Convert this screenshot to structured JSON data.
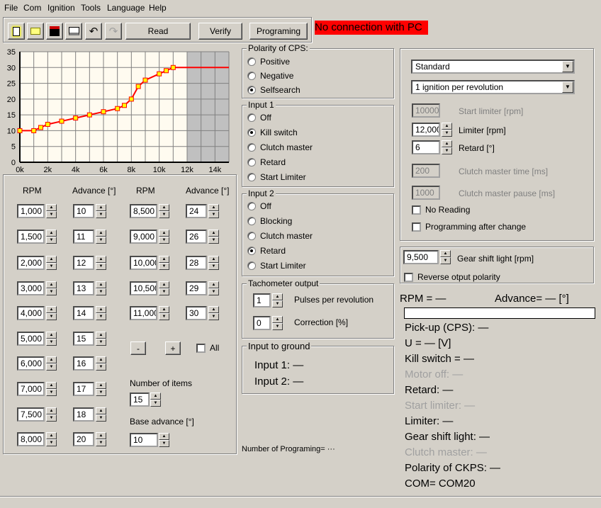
{
  "menu": [
    "File",
    "Com",
    "Ignition",
    "Tools",
    "Language",
    "Help"
  ],
  "toolbar": {
    "icons": [
      "new-file-icon",
      "open-folder-icon",
      "save-icon",
      "print-icon",
      "undo-icon",
      "redo-icon"
    ],
    "read": "Read",
    "verify": "Verify",
    "programing": "Programing"
  },
  "connection_status": "No connection with PC",
  "colors": {
    "status_bg": "#ff0000",
    "curve": "#ff0000",
    "point": "#ffff00",
    "plot_bg": "#fffbf0",
    "disabled_region": "#c0c0c0"
  },
  "chart_data": {
    "type": "line",
    "xlim": [
      0,
      15000
    ],
    "ylim": [
      0,
      35
    ],
    "grid": true,
    "xticks": [
      "0k",
      "2k",
      "4k",
      "6k",
      "8k",
      "10k",
      "12k",
      "14k"
    ],
    "yticks": [
      "0",
      "5",
      "10",
      "15",
      "20",
      "25",
      "30",
      "35"
    ],
    "points": [
      [
        0,
        10
      ],
      [
        1000,
        10
      ],
      [
        1500,
        11
      ],
      [
        2000,
        12
      ],
      [
        3000,
        13
      ],
      [
        4000,
        14
      ],
      [
        5000,
        15
      ],
      [
        6000,
        16
      ],
      [
        7000,
        17
      ],
      [
        7500,
        18
      ],
      [
        8000,
        20
      ],
      [
        8500,
        24
      ],
      [
        9000,
        26
      ],
      [
        10000,
        28
      ],
      [
        10500,
        29
      ],
      [
        11000,
        30
      ]
    ],
    "line_extends_to": 15000,
    "shaded_from": 12000
  },
  "table": {
    "headers": [
      "RPM",
      "Advance [°]",
      "RPM",
      "Advance [°]"
    ],
    "col1": [
      {
        "rpm": "1,000",
        "adv": "10"
      },
      {
        "rpm": "1,500",
        "adv": "11"
      },
      {
        "rpm": "2,000",
        "adv": "12"
      },
      {
        "rpm": "3,000",
        "adv": "13"
      },
      {
        "rpm": "4,000",
        "adv": "14"
      },
      {
        "rpm": "5,000",
        "adv": "15"
      },
      {
        "rpm": "6,000",
        "adv": "16"
      },
      {
        "rpm": "7,000",
        "adv": "17"
      },
      {
        "rpm": "7,500",
        "adv": "18"
      },
      {
        "rpm": "8,000",
        "adv": "20"
      }
    ],
    "col2": [
      {
        "rpm": "8,500",
        "adv": "24"
      },
      {
        "rpm": "9,000",
        "adv": "26"
      },
      {
        "rpm": "10,000",
        "adv": "28"
      },
      {
        "rpm": "10,500",
        "adv": "29"
      },
      {
        "rpm": "11,000",
        "adv": "30"
      }
    ],
    "minus": "-",
    "plus": "+",
    "all": "All",
    "num_items_label": "Number of items",
    "num_items": "15",
    "base_adv_label": "Base advance [°]",
    "base_adv": "10"
  },
  "polarity": {
    "title": "Polarity of CPS:",
    "options": [
      "Positive",
      "Negative",
      "Selfsearch"
    ],
    "selected": 2
  },
  "input1": {
    "title": "Input 1",
    "options": [
      "Off",
      "Kill switch",
      "Clutch master",
      "Retard",
      "Start Limiter"
    ],
    "selected": 1
  },
  "input2": {
    "title": "Input 2",
    "options": [
      "Off",
      "Blocking",
      "Clutch master",
      "Retard",
      "Start Limiter"
    ],
    "selected": 3
  },
  "tacho": {
    "title": "Tachometer output",
    "pulses": "1",
    "pulses_label": "Pulses per revolution",
    "correction": "0",
    "correction_label": "Correction [%]"
  },
  "ground": {
    "title": "Input to ground",
    "input1": "Input 1: —",
    "input2": "Input 2: —"
  },
  "num_programing": "Number of Programing=  ···",
  "settings": {
    "mode": "Standard",
    "ignition": "1 ignition per revolution",
    "start_limiter": "10000",
    "start_limiter_label": "Start limiter [rpm]",
    "limiter": "12,000",
    "limiter_label": "Limiter [rpm]",
    "retard": "6",
    "retard_label": "Retard [°]",
    "cm_time": "200",
    "cm_time_label": "Clutch master time [ms]",
    "cm_pause": "1000",
    "cm_pause_label": "Clutch master pause [ms]",
    "no_reading": "No Reading",
    "prog_after": "Programming after change"
  },
  "gear": {
    "value": "9,500",
    "label": "Gear shift light [rpm]",
    "reverse": "Reverse otput polarity"
  },
  "status": {
    "rpm": "RPM = —",
    "advance": "Advance= — [°]",
    "progress": 0,
    "lines": [
      {
        "t": "Pick-up (CPS): —",
        "d": false
      },
      {
        "t": "U = — [V]",
        "d": false
      },
      {
        "t": "Kill switch = —",
        "d": false
      },
      {
        "t": "Motor off: —",
        "d": true
      },
      {
        "t": "Retard: —",
        "d": false
      },
      {
        "t": "Start limiter: —",
        "d": true
      },
      {
        "t": "Limiter: —",
        "d": false
      },
      {
        "t": "Gear shift light: —",
        "d": false
      },
      {
        "t": "Clutch master: —",
        "d": true
      },
      {
        "t": "Polarity of CKPS: —",
        "d": false
      },
      {
        "t": "COM= COM20",
        "d": false
      }
    ]
  }
}
